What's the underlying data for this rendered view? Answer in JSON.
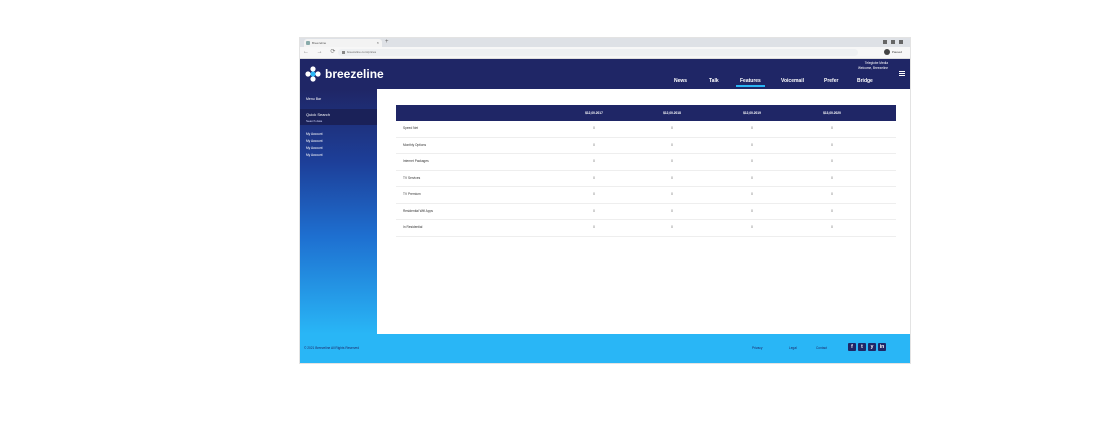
{
  "browser": {
    "tab_title": "Breezeline",
    "tab_close": "×",
    "new_tab": "+",
    "nav_buttons": "←  →  ⟳",
    "url": "breezeline.com/prices",
    "profile_label": "Paused"
  },
  "header": {
    "logo_text": "breezeline",
    "tagline_line1": "Teleglobe Media",
    "tagline_line2": "Welcome, Breezeline",
    "nav": [
      {
        "label": "News"
      },
      {
        "label": "Talk"
      },
      {
        "label": "Features"
      },
      {
        "label": "Voicemail"
      },
      {
        "label": "Prefer"
      },
      {
        "label": "Bridge"
      }
    ],
    "active_index": 2
  },
  "sidebar": {
    "title": "Menu Bar",
    "search_label": "Quick Search",
    "search_sub": "Search data",
    "links": [
      "My Account",
      "My Account",
      "My Account",
      "My Account"
    ]
  },
  "table": {
    "columns": [
      "$12,00.2017",
      "$12,00.2018",
      "$12,00.2019",
      "$13,00.2020"
    ],
    "rows": [
      {
        "label": "Speed Net",
        "values": [
          "0",
          "0",
          "0",
          "0"
        ]
      },
      {
        "label": "Monthly Options",
        "values": [
          "0",
          "0",
          "0",
          "0"
        ]
      },
      {
        "label": "Internet Packages",
        "values": [
          "0",
          "0",
          "0",
          "0"
        ]
      },
      {
        "label": "TV Services",
        "values": [
          "0",
          "0",
          "0",
          "0"
        ]
      },
      {
        "label": "TV Premium",
        "values": [
          "0",
          "0",
          "0",
          "0"
        ]
      },
      {
        "label": "Residential Wifi Apps",
        "values": [
          "0",
          "0",
          "0",
          "0"
        ]
      },
      {
        "label": "In Residential",
        "values": [
          "0",
          "0",
          "0",
          "0"
        ]
      }
    ]
  },
  "footer": {
    "copyright": "© 2021 Breezeline All Rights Reserved",
    "links": [
      "Privacy",
      "Legal",
      "Contact"
    ],
    "social": [
      "f",
      "t",
      "y",
      "in"
    ]
  },
  "colors": {
    "navy": "#1f2666",
    "accent": "#29b6f6"
  }
}
